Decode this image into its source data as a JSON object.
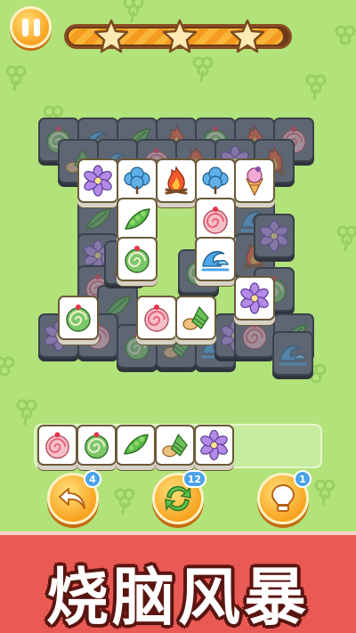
{
  "header": {
    "pause_icon": "pause-icon",
    "progress_fraction": 0.98,
    "stars_earned": 3,
    "stars_total": 3
  },
  "colors": {
    "background": "#b2e27a",
    "accent_orange": "#f8a321",
    "banner_red": "#ea5a55",
    "badge_blue": "#4aa3e8"
  },
  "board": {
    "dark_tiles": [
      {
        "icon": "cake-icon"
      },
      {
        "icon": "wave-icon"
      },
      {
        "icon": "leaf-icon"
      },
      {
        "icon": "fire-icon"
      },
      {
        "icon": "cake-icon"
      },
      {
        "icon": "fire-icon"
      },
      {
        "icon": "roll-icon"
      },
      {
        "icon": "dumpling-icon"
      },
      {
        "icon": "wave-icon"
      },
      {
        "icon": "roll-icon"
      },
      {
        "icon": "fire-icon"
      },
      {
        "icon": "flower-icon"
      },
      {
        "icon": "fire-icon"
      },
      {
        "icon": "leaf-icon"
      },
      {
        "icon": "flower-icon"
      },
      {
        "icon": "wave-icon"
      },
      {
        "icon": "fire-icon"
      },
      {
        "icon": "flower-icon"
      },
      {
        "icon": "roll-icon"
      },
      {
        "icon": "leaf-icon"
      },
      {
        "icon": "cake-icon"
      },
      {
        "icon": "wave-icon"
      },
      {
        "icon": "flower-icon"
      },
      {
        "icon": "roll-icon"
      },
      {
        "icon": "cake-icon"
      },
      {
        "icon": "dumpling-icon"
      },
      {
        "icon": "wave-icon"
      },
      {
        "icon": "flower-icon"
      },
      {
        "icon": "roll-icon"
      },
      {
        "icon": "leaf-icon"
      },
      {
        "icon": "fire-icon"
      },
      {
        "icon": "cake-icon"
      },
      {
        "icon": "wave-icon"
      }
    ],
    "light_tiles": [
      {
        "icon": "flower-icon"
      },
      {
        "icon": "cotton-icon"
      },
      {
        "icon": "fire-icon"
      },
      {
        "icon": "cotton-icon"
      },
      {
        "icon": "icecream-icon"
      },
      {
        "icon": "peapod-icon"
      },
      {
        "icon": "roll-icon"
      },
      {
        "icon": "cake-icon"
      },
      {
        "icon": "wave-icon"
      },
      {
        "icon": "flower-icon"
      },
      {
        "icon": "cake-icon"
      },
      {
        "icon": "roll-icon"
      },
      {
        "icon": "dumpling-icon"
      }
    ]
  },
  "tray": {
    "slots": [
      {
        "icon": "roll-icon"
      },
      {
        "icon": "cake-icon"
      },
      {
        "icon": "peapod-icon"
      },
      {
        "icon": "dumpling-icon"
      },
      {
        "icon": "flower-icon"
      }
    ],
    "capacity": 7
  },
  "controls": {
    "undo": {
      "icon": "undo-icon",
      "count": "4"
    },
    "shuffle": {
      "icon": "shuffle-icon",
      "count": "12"
    },
    "hint": {
      "icon": "lightbulb-icon",
      "count": "1"
    }
  },
  "banner": {
    "title": "烧脑风暴"
  }
}
